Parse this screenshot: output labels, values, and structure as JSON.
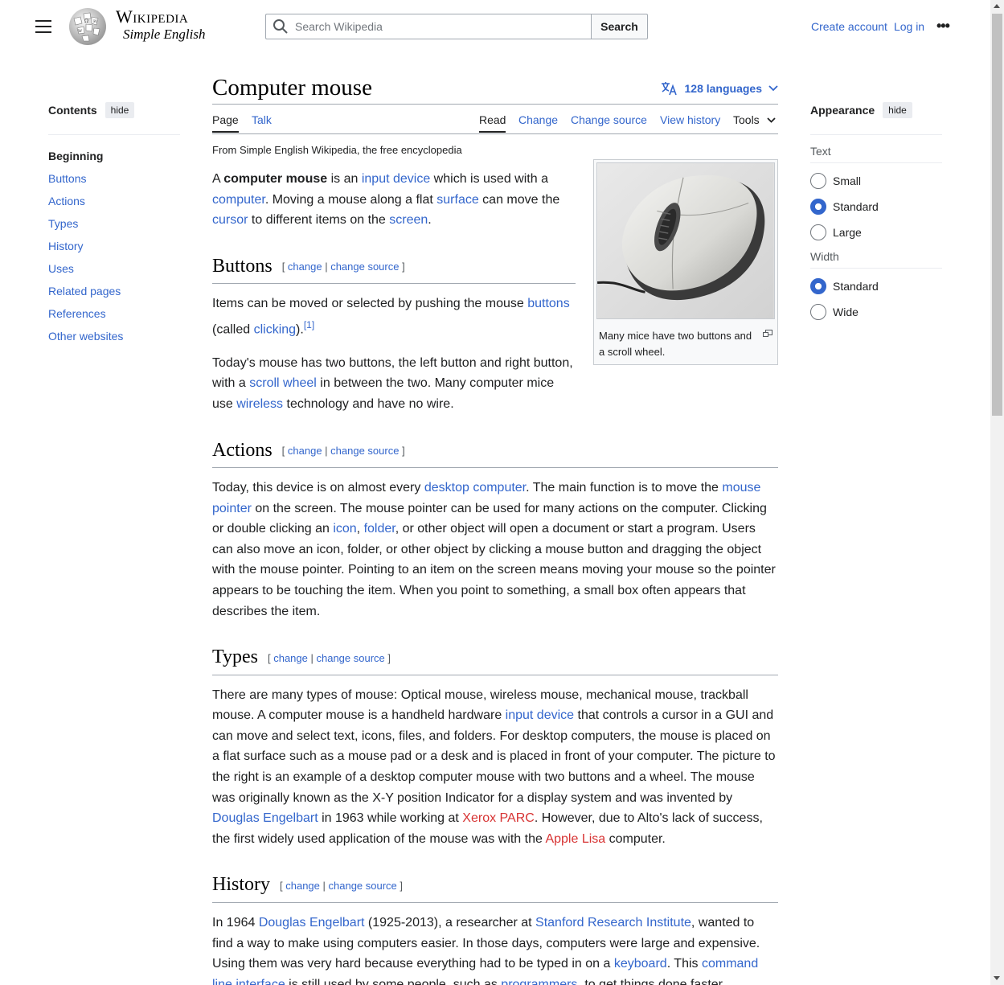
{
  "header": {
    "logo_word": "Wikipedia",
    "logo_tagline": "Simple English",
    "search_placeholder": "Search Wikipedia",
    "search_button": "Search",
    "create_account": "Create account",
    "log_in": "Log in"
  },
  "toc": {
    "title": "Contents",
    "hide": "hide",
    "items": [
      "Beginning",
      "Buttons",
      "Actions",
      "Types",
      "History",
      "Uses",
      "Related pages",
      "References",
      "Other websites"
    ]
  },
  "article": {
    "title": "Computer mouse",
    "languages": "128 languages",
    "tabs": {
      "page": "Page",
      "talk": "Talk",
      "read": "Read",
      "change": "Change",
      "change_source": "Change source",
      "view_history": "View history",
      "tools": "Tools"
    },
    "tagline": "From Simple English Wikipedia, the free encyclopedia",
    "infobox_caption": "Many mice have two buttons and a scroll wheel.",
    "edit": {
      "change": "change",
      "change_source": "change source"
    },
    "intro": {
      "t1": "A ",
      "b1": "computer mouse",
      "t2": " is an ",
      "l1": "input device",
      "t3": " which is used with a ",
      "l2": "computer",
      "t4": ". Moving a mouse along a flat ",
      "l3": "surface",
      "t5": " can move the ",
      "l4": "cursor",
      "t6": " to different items on the ",
      "l5": "screen",
      "t7": "."
    },
    "buttons": {
      "heading": "Buttons",
      "p1": {
        "t1": "Items can be moved or selected by pushing the mouse ",
        "l1": "buttons",
        "t2": " (called ",
        "l2": "clicking",
        "t3": ").",
        "ref": "[1]"
      },
      "p2": {
        "t1": "Today's mouse has two buttons, the left button and right button, with a ",
        "l1": "scroll wheel",
        "t2": " in between the two. Many computer mice use ",
        "l2": "wireless",
        "t3": " technology and have no wire."
      }
    },
    "actions": {
      "heading": "Actions",
      "p1": {
        "t1": "Today, this device is on almost every ",
        "l1": "desktop computer",
        "t2": ". The main function is to move the ",
        "l2": "mouse pointer",
        "t3": " on the screen. The mouse pointer can be used for many actions on the computer. Clicking or double clicking an ",
        "l3": "icon",
        "t4": ", ",
        "l4": "folder",
        "t5": ", or other object will open a document or start a program. Users can also move an icon, folder, or other object by clicking a mouse button and dragging the object with the mouse pointer. Pointing to an item on the screen means moving your mouse so the pointer appears to be touching the item. When you point to something, a small box often appears that describes the item."
      }
    },
    "types": {
      "heading": "Types",
      "p1": {
        "t1": "There are many types of mouse: Optical mouse, wireless mouse, mechanical mouse, trackball mouse. A computer mouse is a handheld hardware ",
        "l1": "input device",
        "t2": " that controls a cursor in a GUI and can move and select text, icons, files, and folders. For desktop computers, the mouse is placed on a flat surface such as a mouse pad or a desk and is placed in front of your computer. The picture to the right is an example of a desktop computer mouse with two buttons and a wheel. The mouse was originally known as the X-Y position Indicator for a display system and was invented by ",
        "l2": "Douglas Engelbart",
        "t3": " in 1963 while working at ",
        "r1": "Xerox PARC",
        "t4": ". However, due to Alto's lack of success, the first widely used application of the mouse was with the ",
        "r2": "Apple Lisa",
        "t5": " computer."
      }
    },
    "history": {
      "heading": "History",
      "p1": {
        "t1": "In 1964 ",
        "l1": "Douglas Engelbart",
        "t2": " (1925-2013), a researcher at ",
        "l2": "Stanford Research Institute",
        "t3": ", wanted to find a way to make using computers easier. In those days, computers were large and expensive. Using them was very hard because everything had to be typed in on a ",
        "l3": "keyboard",
        "t4": ". This ",
        "l4": "command line interface",
        "t5": " is still used by some people, such as ",
        "l5": "programmers",
        "t6": ", to get things done faster."
      }
    }
  },
  "appearance": {
    "title": "Appearance",
    "hide": "hide",
    "text_label": "Text",
    "text_options": [
      "Small",
      "Standard",
      "Large"
    ],
    "text_selected": "Standard",
    "width_label": "Width",
    "width_options": [
      "Standard",
      "Wide"
    ],
    "width_selected": "Standard"
  },
  "colors": {
    "link": "#3366cc",
    "redlink": "#d73333",
    "text": "#202122"
  }
}
